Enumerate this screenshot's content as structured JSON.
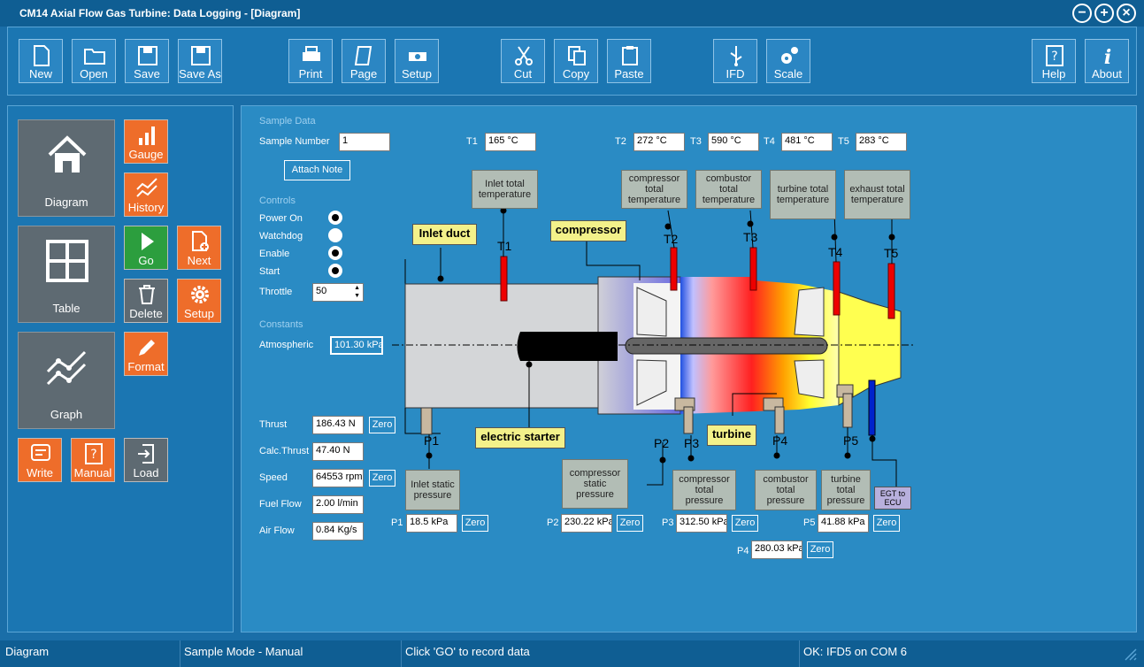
{
  "window": {
    "title": "CM14 Axial Flow Gas Turbine: Data Logging - [Diagram]"
  },
  "toolbar": {
    "new": "New",
    "open": "Open",
    "save": "Save",
    "save_as": "Save As",
    "print": "Print",
    "page": "Page",
    "setup": "Setup",
    "cut": "Cut",
    "copy": "Copy",
    "paste": "Paste",
    "ifd": "IFD",
    "scale": "Scale",
    "help": "Help",
    "about": "About"
  },
  "nav": {
    "diagram": "Diagram",
    "table": "Table",
    "graph": "Graph",
    "gauge": "Gauge",
    "history": "History",
    "go": "Go",
    "next": "Next",
    "delete": "Delete",
    "setup": "Setup",
    "format": "Format",
    "write": "Write",
    "manual": "Manual",
    "load": "Load"
  },
  "sample": {
    "section": "Sample Data",
    "number_label": "Sample Number",
    "number": "1",
    "attach_note": "Attach Note"
  },
  "controls": {
    "section": "Controls",
    "power_on": "Power On",
    "watchdog": "Watchdog",
    "enable": "Enable",
    "start": "Start",
    "power_on_state": true,
    "watchdog_state": false,
    "enable_state": true,
    "start_state": true,
    "throttle_label": "Throttle",
    "throttle": "50"
  },
  "constants": {
    "section": "Constants",
    "atmospheric_label": "Atmospheric",
    "atmospheric": "101.30 kPa"
  },
  "outputs": {
    "thrust_label": "Thrust",
    "thrust": "186.43 N",
    "calc_thrust_label": "Calc.Thrust",
    "calc_thrust": "47.40 N",
    "speed_label": "Speed",
    "speed": "64553 rpm",
    "fuel_flow_label": "Fuel Flow",
    "fuel_flow": "2.00 l/min",
    "air_flow_label": "Air Flow",
    "air_flow": "0.84 Kg/s",
    "zero": "Zero"
  },
  "temperatures": [
    {
      "label": "T1",
      "value": "165 °C",
      "probe": "T1",
      "desc": "Inlet total temperature"
    },
    {
      "label": "T2",
      "value": "272 °C",
      "probe": "T2",
      "desc": "compressor total temperature"
    },
    {
      "label": "T3",
      "value": "590 °C",
      "probe": "T3",
      "desc": "combustor total temperature"
    },
    {
      "label": "T4",
      "value": "481 °C",
      "probe": "T4",
      "desc": "turbine total temperature"
    },
    {
      "label": "T5",
      "value": "283 °C",
      "probe": "T5",
      "desc": "exhaust total temperature"
    }
  ],
  "pressures": [
    {
      "label": "P1",
      "value": "18.5 kPa",
      "probe": "P1",
      "desc": "Inlet static pressure"
    },
    {
      "label": "P2",
      "value": "230.22 kPa",
      "probe": "P2",
      "desc": "compressor static pressure"
    },
    {
      "label": "P3",
      "value": "312.50 kPa",
      "probe": "P3",
      "desc": "compressor total pressure"
    },
    {
      "label": "P4",
      "value": "280.03 kPa",
      "probe": "P4",
      "desc": "combustor total pressure"
    },
    {
      "label": "P5",
      "value": "41.88 kPa",
      "probe": "P5",
      "desc": "turbine total pressure"
    }
  ],
  "diagram": {
    "inlet_duct": "Inlet duct",
    "compressor": "compressor",
    "electric_starter": "electric starter",
    "turbine": "turbine",
    "egt": "EGT to ECU"
  },
  "status": {
    "view": "Diagram",
    "mode": "Sample Mode - Manual",
    "hint": "Click 'GO' to record data",
    "connection": "OK: IFD5 on COM 6"
  }
}
